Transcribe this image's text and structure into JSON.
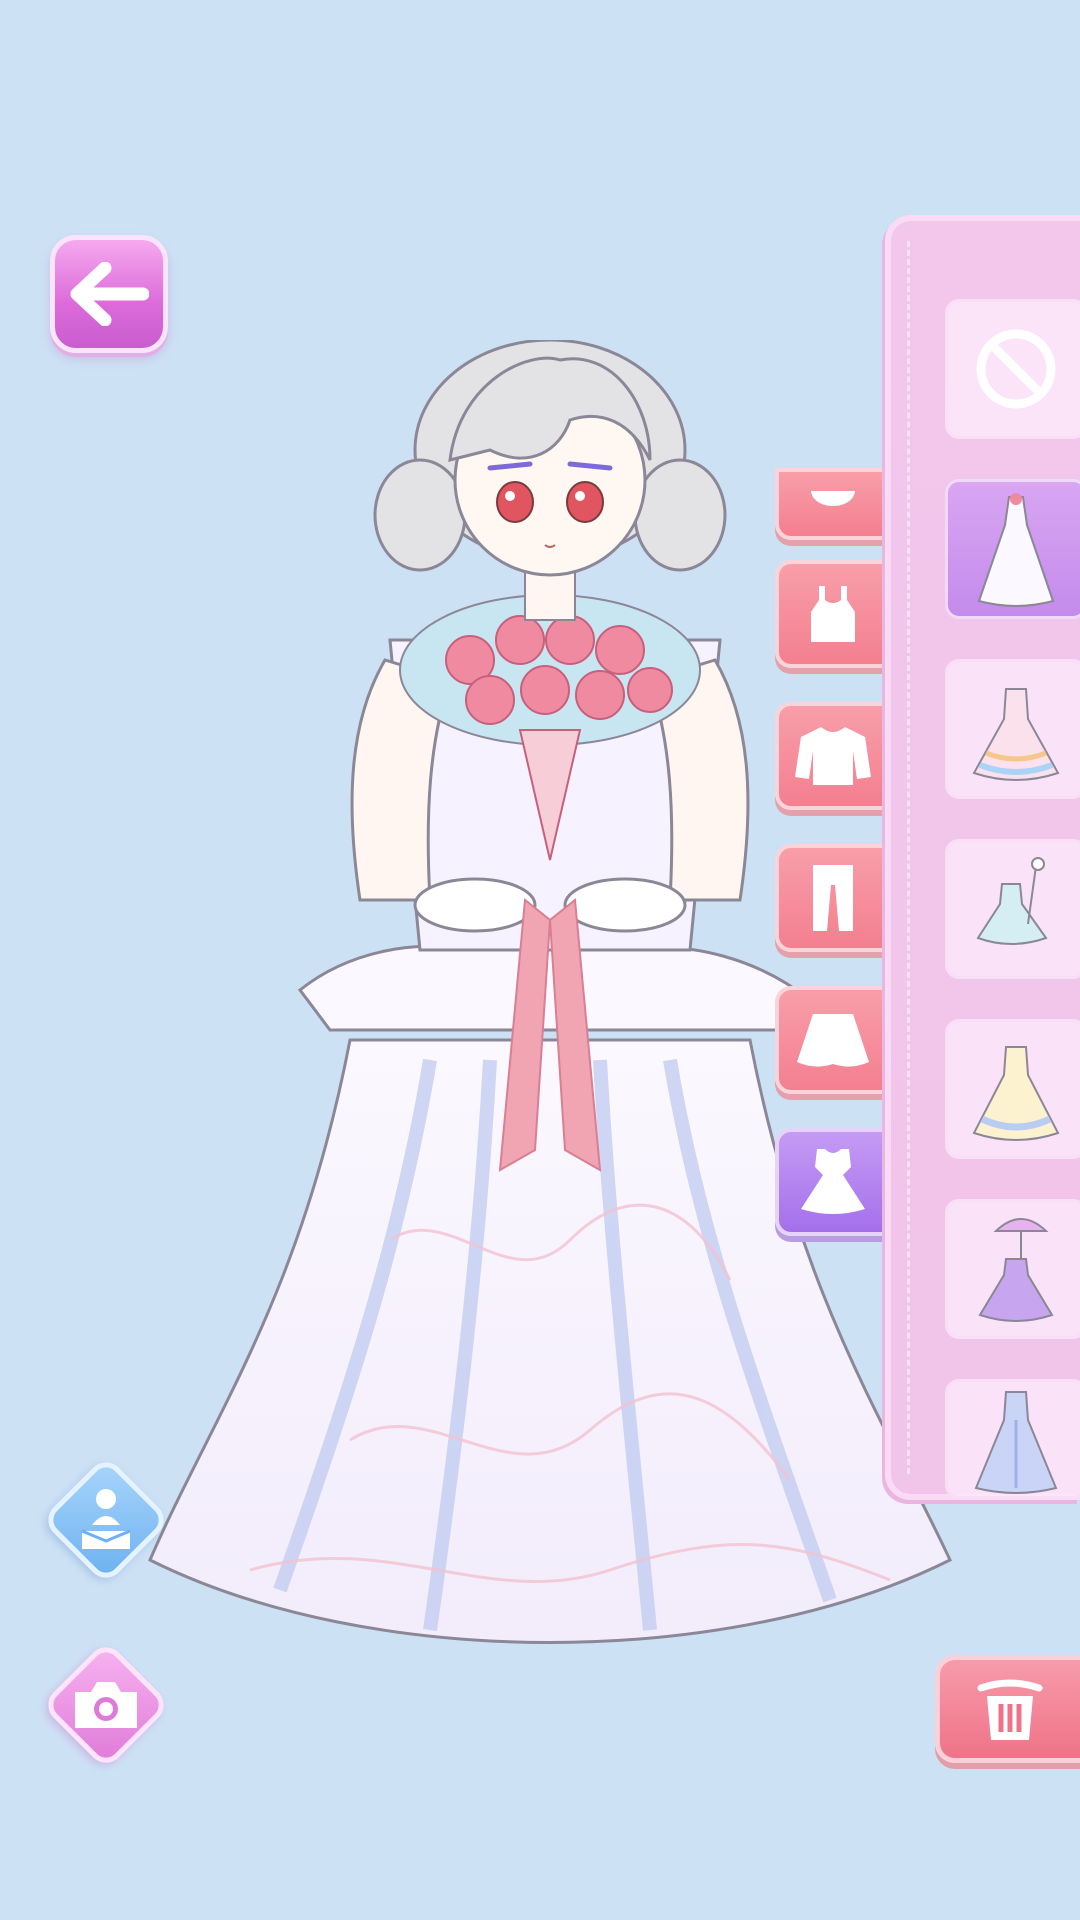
{
  "screen": {
    "background": "#cde1f5"
  },
  "buttons": {
    "back": {
      "icon": "arrow-left-icon"
    },
    "pose": {
      "icon": "person-pedestal-icon"
    },
    "camera": {
      "icon": "camera-icon"
    },
    "trash": {
      "icon": "trash-icon"
    }
  },
  "categories": [
    {
      "id": "face",
      "icon": "face-icon",
      "active": false
    },
    {
      "id": "top",
      "icon": "camisole-icon",
      "active": false
    },
    {
      "id": "jacket",
      "icon": "shirt-icon",
      "active": false
    },
    {
      "id": "pants",
      "icon": "pants-icon",
      "active": false
    },
    {
      "id": "skirt",
      "icon": "skirt-icon",
      "active": false
    },
    {
      "id": "dress",
      "icon": "dress-icon",
      "active": true
    }
  ],
  "items": [
    {
      "id": "none",
      "icon": "none-icon",
      "selected": false
    },
    {
      "id": "wedding-gown",
      "icon": "wedding-gown-icon",
      "selected": true
    },
    {
      "id": "pastel-ruffle-gown",
      "icon": "ruffle-gown-icon",
      "selected": false
    },
    {
      "id": "mint-fairy-dress",
      "icon": "fairy-dress-icon",
      "selected": false
    },
    {
      "id": "cream-blue-gown",
      "icon": "ballgown-icon",
      "selected": false
    },
    {
      "id": "parasol-purple-gown",
      "icon": "parasol-gown-icon",
      "selected": false
    },
    {
      "id": "blue-lace-gown",
      "icon": "lace-gown-icon",
      "selected": false
    }
  ],
  "colors": {
    "accent_pink": "#f47f8f",
    "accent_purple": "#a470ea",
    "panel": "#f3c6ec",
    "back_button": "#dc6ad9"
  }
}
